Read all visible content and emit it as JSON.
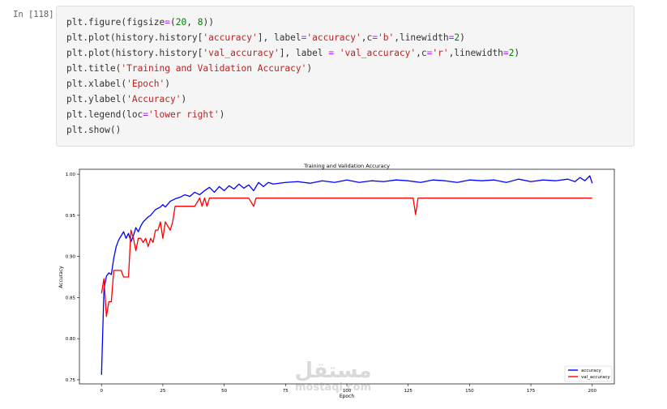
{
  "cell": {
    "prompt": "In [118]:",
    "code_lines": [
      [
        {
          "t": "plt.figure(figsize"
        },
        {
          "t": "=",
          "c": "op"
        },
        {
          "t": "("
        },
        {
          "t": "20",
          "c": "num"
        },
        {
          "t": ", "
        },
        {
          "t": "8",
          "c": "num"
        },
        {
          "t": "))"
        }
      ],
      [
        {
          "t": "plt.plot(history.history["
        },
        {
          "t": "'accuracy'",
          "c": "str"
        },
        {
          "t": "], label"
        },
        {
          "t": "=",
          "c": "op"
        },
        {
          "t": "'accuracy'",
          "c": "str"
        },
        {
          "t": ",c"
        },
        {
          "t": "=",
          "c": "op"
        },
        {
          "t": "'b'",
          "c": "str"
        },
        {
          "t": ",linewidth"
        },
        {
          "t": "=",
          "c": "op"
        },
        {
          "t": "2",
          "c": "num"
        },
        {
          "t": ")"
        }
      ],
      [
        {
          "t": "plt.plot(history.history["
        },
        {
          "t": "'val_accuracy'",
          "c": "str"
        },
        {
          "t": "], label "
        },
        {
          "t": "=",
          "c": "op"
        },
        {
          "t": " "
        },
        {
          "t": "'val_accuracy'",
          "c": "str"
        },
        {
          "t": ",c"
        },
        {
          "t": "=",
          "c": "op"
        },
        {
          "t": "'r'",
          "c": "str"
        },
        {
          "t": ",linewidth"
        },
        {
          "t": "=",
          "c": "op"
        },
        {
          "t": "2",
          "c": "num"
        },
        {
          "t": ")"
        }
      ],
      [
        {
          "t": "plt.title("
        },
        {
          "t": "'Training and Validation Accuracy'",
          "c": "str"
        },
        {
          "t": ")"
        }
      ],
      [
        {
          "t": "plt.xlabel("
        },
        {
          "t": "'Epoch'",
          "c": "str"
        },
        {
          "t": ")"
        }
      ],
      [
        {
          "t": "plt.ylabel("
        },
        {
          "t": "'Accuracy'",
          "c": "str"
        },
        {
          "t": ")"
        }
      ],
      [
        {
          "t": "plt.legend(loc"
        },
        {
          "t": "=",
          "c": "op"
        },
        {
          "t": "'lower right'",
          "c": "str"
        },
        {
          "t": ")"
        }
      ],
      [
        {
          "t": "plt.show()"
        }
      ]
    ]
  },
  "colors": {
    "accuracy": "#0000ff",
    "val_accuracy": "#ff0000",
    "code_string": "#ba2121",
    "code_number": "#008000",
    "code_operator": "#aa22ff"
  },
  "watermark": {
    "arabic": "مستقل",
    "latin": "mostaql.com"
  },
  "chart_data": {
    "type": "line",
    "title": "Training and Validation Accuracy",
    "xlabel": "Epoch",
    "ylabel": "Accuracy",
    "xlim": [
      -9,
      209
    ],
    "ylim": [
      0.745,
      1.006
    ],
    "xticks": [
      0,
      25,
      50,
      75,
      100,
      125,
      150,
      175,
      200
    ],
    "yticks": [
      0.75,
      0.8,
      0.85,
      0.9,
      0.95,
      1.0
    ],
    "xtick_labels": [
      "0",
      "25",
      "50",
      "75",
      "100",
      "125",
      "150",
      "175",
      "200"
    ],
    "ytick_labels": [
      "0.75",
      "0.80",
      "0.85",
      "0.90",
      "0.95",
      "1.00"
    ],
    "legend_loc": "lower right",
    "grid": false,
    "series": [
      {
        "name": "accuracy",
        "color": "#0000ff",
        "x": [
          0,
          1,
          2,
          3,
          4,
          5,
          6,
          7,
          8,
          9,
          10,
          11,
          12,
          13,
          14,
          15,
          16,
          17,
          18,
          19,
          20,
          22,
          24,
          25,
          26,
          28,
          30,
          32,
          34,
          36,
          38,
          40,
          42,
          44,
          46,
          48,
          50,
          52,
          54,
          56,
          58,
          60,
          62,
          64,
          66,
          68,
          70,
          75,
          80,
          85,
          90,
          95,
          100,
          105,
          110,
          115,
          120,
          125,
          130,
          135,
          140,
          145,
          150,
          155,
          160,
          165,
          170,
          175,
          180,
          185,
          190,
          193,
          195,
          197,
          199,
          200
        ],
        "y": [
          0.756,
          0.86,
          0.876,
          0.88,
          0.878,
          0.898,
          0.912,
          0.92,
          0.925,
          0.93,
          0.922,
          0.928,
          0.918,
          0.925,
          0.935,
          0.93,
          0.937,
          0.942,
          0.945,
          0.948,
          0.95,
          0.957,
          0.96,
          0.963,
          0.96,
          0.967,
          0.97,
          0.972,
          0.975,
          0.973,
          0.978,
          0.975,
          0.98,
          0.984,
          0.978,
          0.985,
          0.98,
          0.986,
          0.982,
          0.988,
          0.983,
          0.987,
          0.98,
          0.99,
          0.985,
          0.99,
          0.988,
          0.99,
          0.991,
          0.989,
          0.992,
          0.99,
          0.993,
          0.99,
          0.992,
          0.991,
          0.993,
          0.992,
          0.99,
          0.993,
          0.992,
          0.99,
          0.993,
          0.992,
          0.993,
          0.99,
          0.994,
          0.991,
          0.993,
          0.992,
          0.994,
          0.991,
          0.996,
          0.992,
          0.998,
          0.989
        ]
      },
      {
        "name": "val_accuracy",
        "color": "#ff0000",
        "x": [
          0,
          1,
          2,
          3,
          4,
          5,
          6,
          7,
          8,
          9,
          10,
          11,
          12,
          13,
          14,
          15,
          16,
          17,
          18,
          19,
          20,
          21,
          22,
          23,
          24,
          25,
          26,
          27,
          28,
          29,
          30,
          32,
          34,
          36,
          38,
          40,
          41,
          42,
          43,
          44,
          45,
          46,
          50,
          55,
          60,
          62,
          63,
          65,
          70,
          80,
          100,
          120,
          127,
          128,
          129,
          135,
          150,
          175,
          200
        ],
        "y": [
          0.855,
          0.873,
          0.827,
          0.845,
          0.845,
          0.883,
          0.883,
          0.883,
          0.883,
          0.875,
          0.875,
          0.875,
          0.932,
          0.922,
          0.907,
          0.922,
          0.922,
          0.917,
          0.922,
          0.912,
          0.922,
          0.917,
          0.932,
          0.932,
          0.942,
          0.922,
          0.942,
          0.937,
          0.932,
          0.942,
          0.961,
          0.961,
          0.961,
          0.961,
          0.961,
          0.971,
          0.961,
          0.971,
          0.961,
          0.971,
          0.971,
          0.971,
          0.971,
          0.971,
          0.971,
          0.961,
          0.971,
          0.971,
          0.971,
          0.971,
          0.971,
          0.971,
          0.971,
          0.951,
          0.971,
          0.971,
          0.971,
          0.971,
          0.971
        ]
      }
    ]
  }
}
